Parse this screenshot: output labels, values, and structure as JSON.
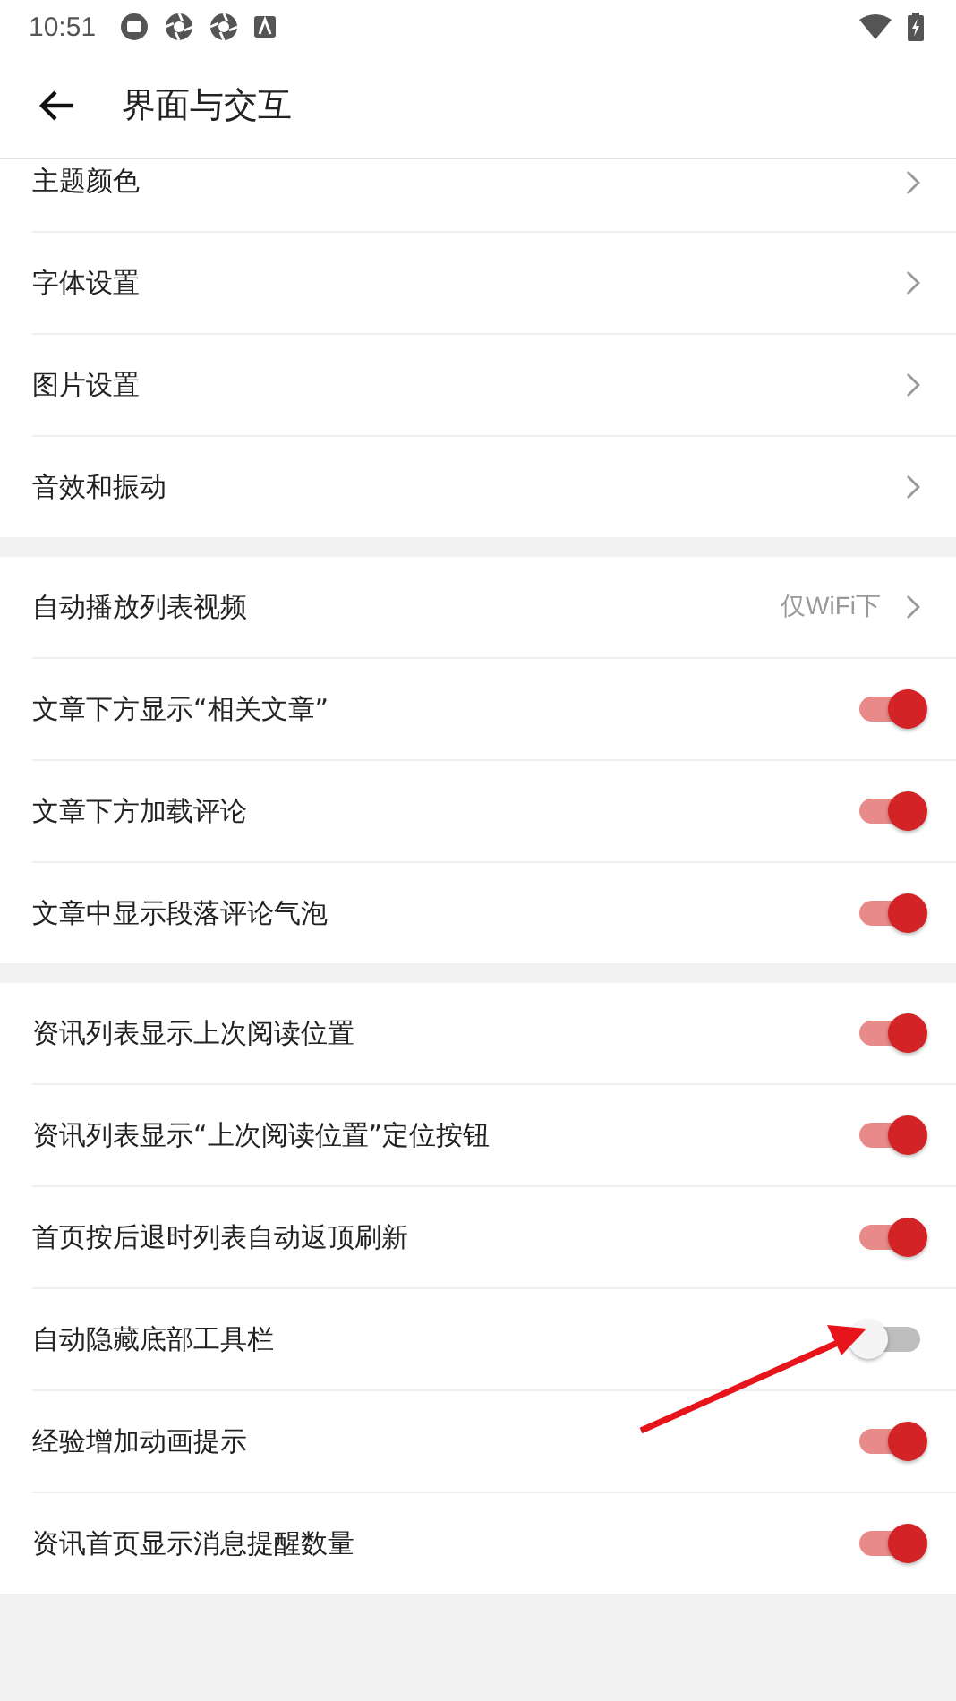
{
  "status_bar": {
    "time": "10:51"
  },
  "header": {
    "title": "界面与交互"
  },
  "groups": [
    {
      "items": [
        {
          "kind": "link",
          "label": "主题颜色"
        },
        {
          "kind": "link",
          "label": "字体设置"
        },
        {
          "kind": "link",
          "label": "图片设置"
        },
        {
          "kind": "link",
          "label": "音效和振动"
        }
      ]
    },
    {
      "items": [
        {
          "kind": "link",
          "label": "自动播放列表视频",
          "value": "仅WiFi下"
        },
        {
          "kind": "toggle",
          "label": "文章下方显示“相关文章”",
          "on": true
        },
        {
          "kind": "toggle",
          "label": "文章下方加载评论",
          "on": true
        },
        {
          "kind": "toggle",
          "label": "文章中显示段落评论气泡",
          "on": true
        }
      ]
    },
    {
      "items": [
        {
          "kind": "toggle",
          "label": "资讯列表显示上次阅读位置",
          "on": true
        },
        {
          "kind": "toggle",
          "label": "资讯列表显示“上次阅读位置”定位按钮",
          "on": true
        },
        {
          "kind": "toggle",
          "label": "首页按后退时列表自动返顶刷新",
          "on": true
        },
        {
          "kind": "toggle",
          "label": "自动隐藏底部工具栏",
          "on": false
        },
        {
          "kind": "toggle",
          "label": "经验增加动画提示",
          "on": true
        },
        {
          "kind": "toggle",
          "label": "资讯首页显示消息提醒数量",
          "on": true
        }
      ]
    }
  ]
}
